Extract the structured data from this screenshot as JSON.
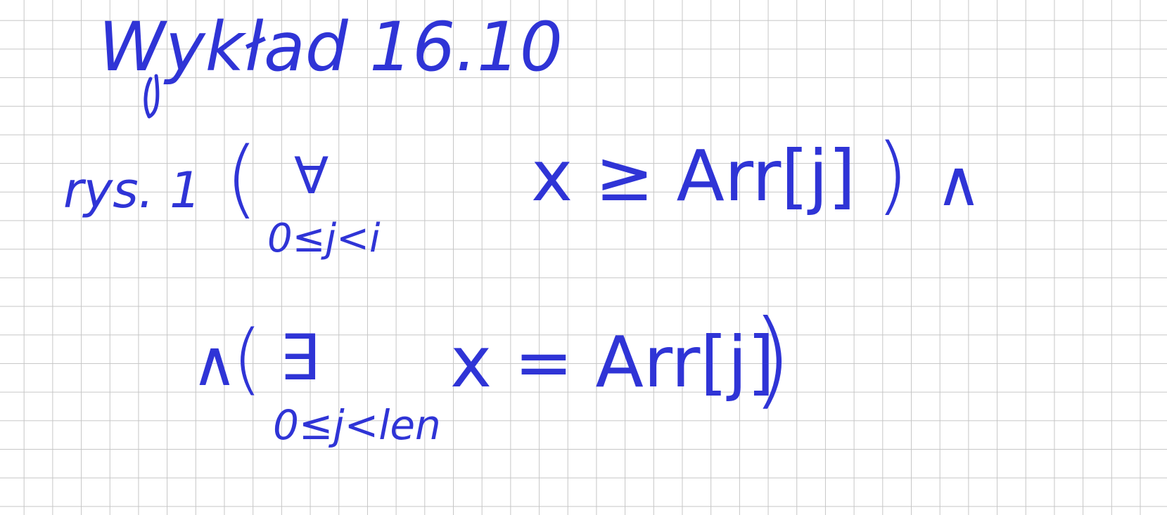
{
  "note": {
    "title": "Wykład 16.10",
    "figure_label": "rys. 1",
    "line1": {
      "open_paren": "(",
      "quantifier": "∀",
      "quantifier_range": "0≤j<i",
      "predicate": "x ≥ Arr[j]",
      "close_paren": ")",
      "and": "∧"
    },
    "line2": {
      "and": "∧",
      "open_paren": "(",
      "quantifier": "∃",
      "quantifier_range": "0≤j<len",
      "predicate": "x = Arr[j]",
      "close_paren": ")"
    }
  },
  "ink_color": "#2f34d6",
  "grid_color": "#c6c6c6"
}
